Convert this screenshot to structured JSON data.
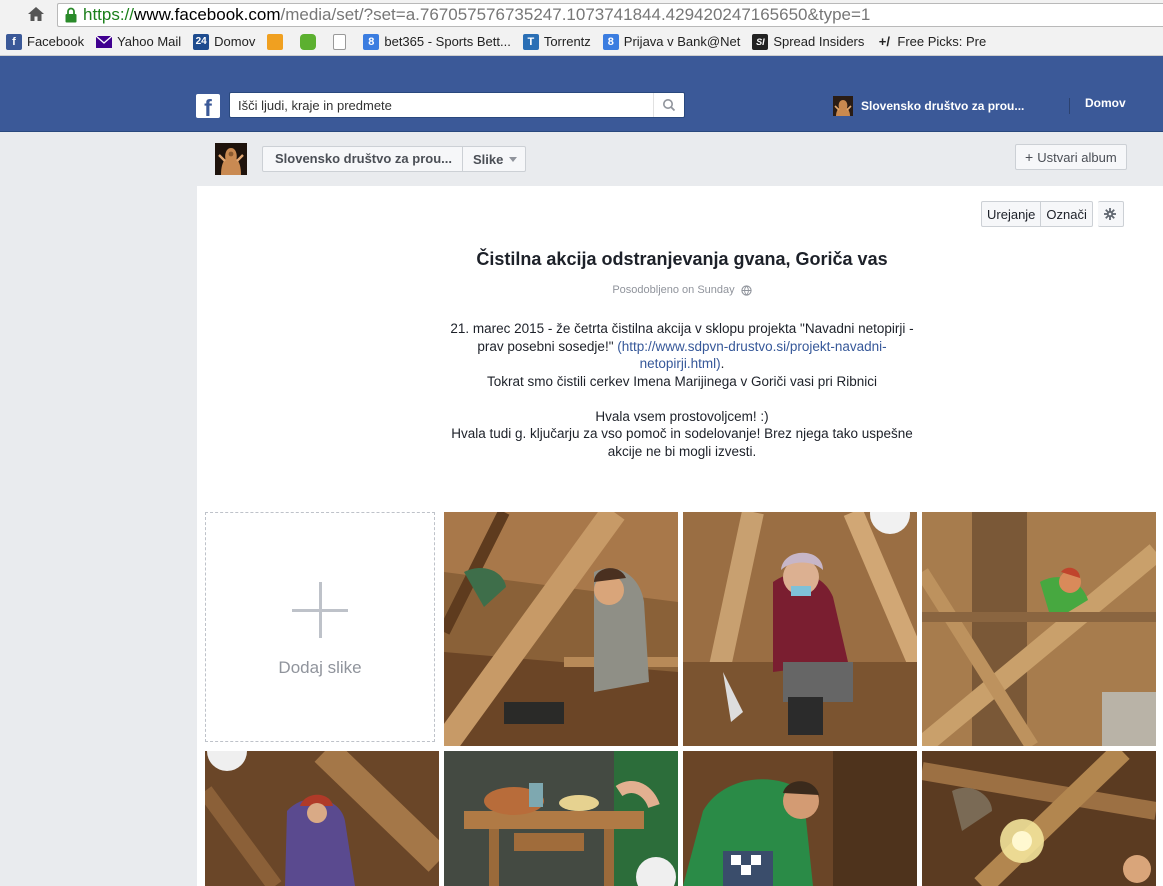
{
  "browser": {
    "url_scheme": "https://",
    "url_host": "www.facebook.com",
    "url_path": "/media/set/?set=a.767057576735247.1073741844.429420247165650&type=1",
    "bookmarks": [
      {
        "label": "Facebook",
        "icon": "facebook-icon",
        "color": "#3b5998",
        "glyph": "f"
      },
      {
        "label": "Yahoo Mail",
        "icon": "envelope-icon",
        "color": "#400090",
        "glyph": ""
      },
      {
        "label": "Domov",
        "icon": "24ur-icon",
        "color": "#1e4c8f",
        "glyph": "24"
      },
      {
        "label": "",
        "icon": "orange-app-icon",
        "color": "#f0a020",
        "glyph": ""
      },
      {
        "label": "",
        "icon": "green-app-icon",
        "color": "#5cb030",
        "glyph": ""
      },
      {
        "label": "",
        "icon": "blank-page-icon",
        "color": "#ffffff",
        "glyph": ""
      },
      {
        "label": "bet365 - Sports Bett...",
        "icon": "google-8-icon",
        "color": "#3b7de0",
        "glyph": "8"
      },
      {
        "label": "Torrentz",
        "icon": "torrentz-icon",
        "color": "#2a6fb5",
        "glyph": "T"
      },
      {
        "label": "Prijava v Bank@Net",
        "icon": "google-8-icon",
        "color": "#3b7de0",
        "glyph": "8"
      },
      {
        "label": "Spread Insiders",
        "icon": "si-icon",
        "color": "#222222",
        "glyph": "SI"
      },
      {
        "label": "Free Picks: Pre",
        "icon": "plus-minus-icon",
        "color": "#f2f2f2",
        "glyph": "+/"
      }
    ]
  },
  "fb": {
    "logo": "f",
    "search_placeholder": "Išči ljudi, kraje in predmete",
    "profile_name": "Slovensko društvo za prou...",
    "home_label": "Domov"
  },
  "header": {
    "page_name": "Slovensko društvo za prou...",
    "section_label": "Slike",
    "create_album_label": "Ustvari album"
  },
  "album": {
    "edit_label": "Urejanje",
    "tag_label": "Označi",
    "title": "Čistilna akcija odstranjevanja gvana, Goriča vas",
    "updated": "Posodobljeno on Sunday",
    "desc_line1": "21. marec 2015 - že četrta čistilna akcija v sklopu projekta \"Navadni netopirji - prav posebni sosedje!\"",
    "desc_link": "(http://www.sdpvn-drustvo.si/projekt-navadni-netopirji.html)",
    "desc_line2": "Tokrat smo čistili cerkev Imena Marijinega v Goriči vasi pri Ribnici",
    "desc_thanks1": "Hvala vsem prostovoljcem! :)",
    "desc_thanks2": "Hvala tudi g. ključarju za vso pomoč in sodelovanje! Brez njega tako uspešne akcije ne bi mogli izvesti.",
    "add_photos_label": "Dodaj slike"
  },
  "colors": {
    "fb_blue": "#3b5998",
    "link": "#365899",
    "wood_light": "#b98a55",
    "wood_dark": "#5a3a1f"
  }
}
